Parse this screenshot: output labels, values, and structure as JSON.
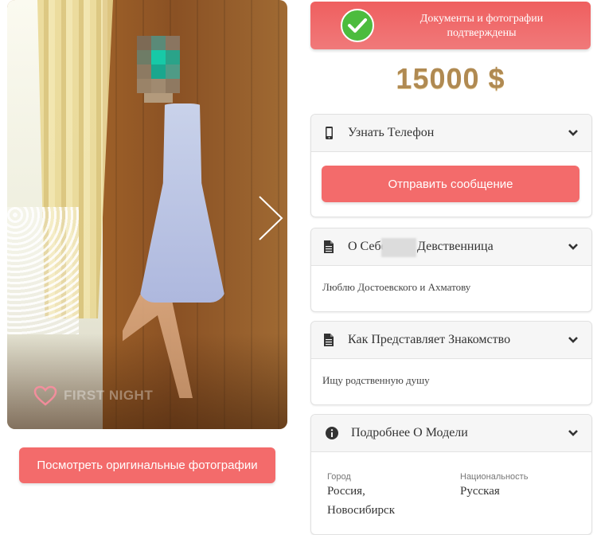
{
  "photo": {
    "watermark": "FIRST NIGHT",
    "next_icon": "chevron-right-icon",
    "heart_icon": "heart-outline-icon"
  },
  "view_originals_label": "Посмотреть оригинальные фотографии",
  "verified": {
    "text": "Документы и фотографии подтверждены",
    "icon": "check-circle-icon",
    "color": "#ef5f5f"
  },
  "price": "15000 $",
  "panels": {
    "phone": {
      "title": "Узнать Телефон",
      "icon": "mobile-phone-icon",
      "button_label": "Отправить сообщение"
    },
    "about": {
      "title_prefix": "О Себе",
      "title_suffix": "Девственница",
      "icon": "document-icon",
      "text": "Люблю Достоевского и Ахматову"
    },
    "meeting": {
      "title": "Как Представляет Знакомство",
      "icon": "document-icon",
      "text": "Ищу родственную душу"
    },
    "details": {
      "title": "Подробнее О Модели",
      "icon": "info-circle-icon",
      "city_label": "Город",
      "city_line1": "Россия,",
      "city_line2": "Новосибирск",
      "nationality_label": "Национальность",
      "nationality": "Русская"
    }
  },
  "colors": {
    "accent": "#f36b6b",
    "price_gold": "#b08a52",
    "verified_green": "#4cbc3e"
  }
}
